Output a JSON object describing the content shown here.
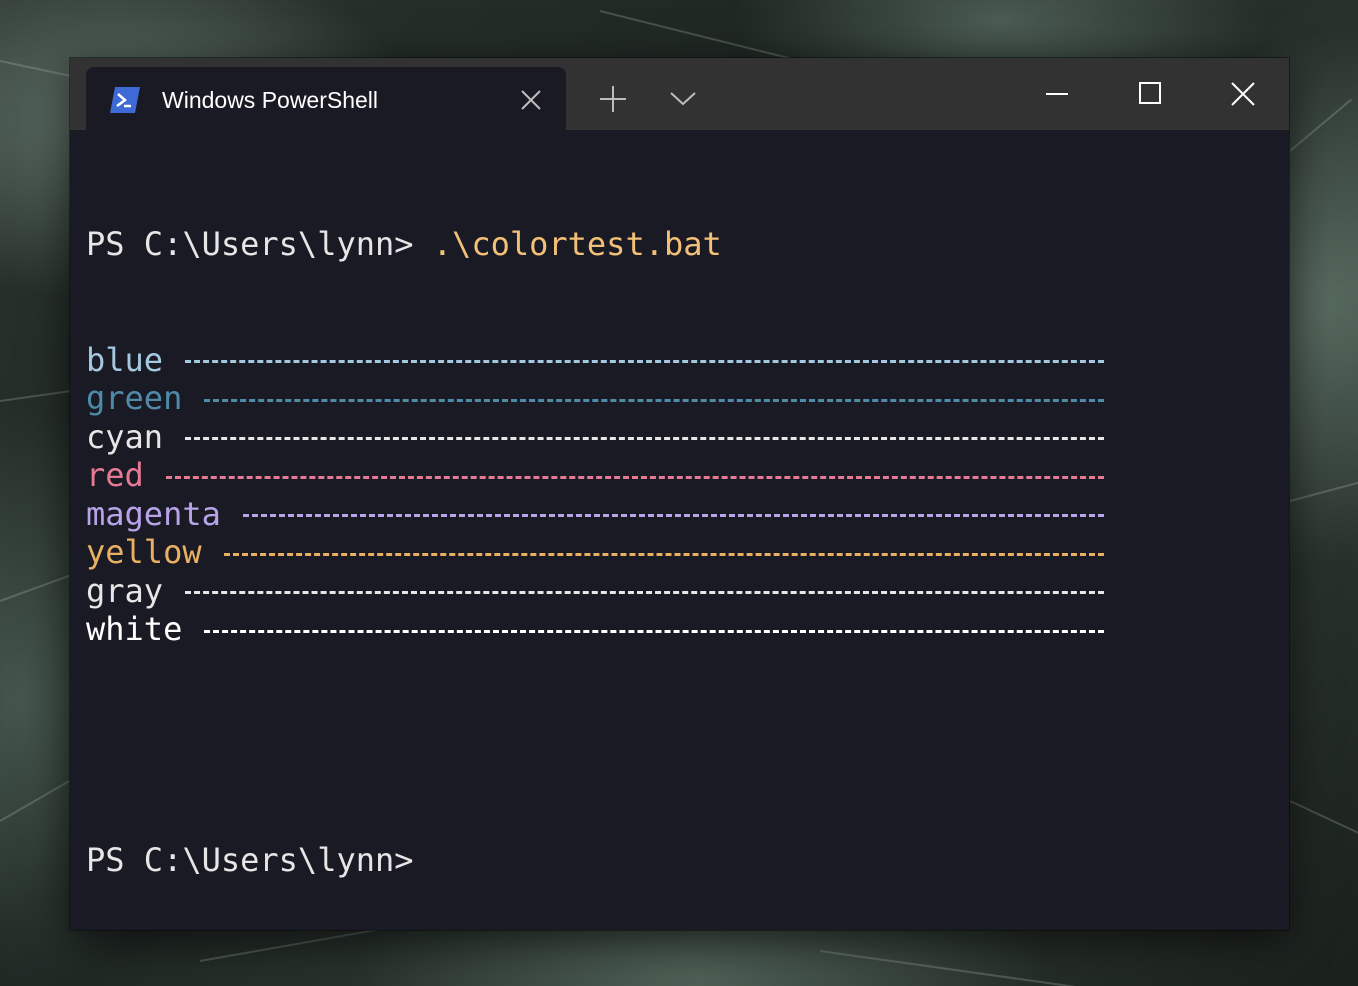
{
  "window": {
    "tab_title": "Windows PowerShell"
  },
  "icons": {
    "tab_icon": "powershell-icon",
    "tab_close": "close-icon",
    "new_tab": "plus-icon",
    "dropdown": "chevron-down-icon",
    "minimize": "minimize-icon",
    "maximize": "maximize-icon",
    "close": "close-icon"
  },
  "terminal": {
    "prompt1": "PS C:\\Users\\lynn>",
    "command1": " .\\colortest.bat",
    "lines": [
      {
        "label": "blue",
        "color": "#a3c8e0"
      },
      {
        "label": "green",
        "color": "#4f8ba8"
      },
      {
        "label": "cyan",
        "color": "#e6e6e6"
      },
      {
        "label": "red",
        "color": "#e57a95"
      },
      {
        "label": "magenta",
        "color": "#b8a3e8"
      },
      {
        "label": "yellow",
        "color": "#e8b063"
      },
      {
        "label": "gray",
        "color": "#e6e6e6"
      },
      {
        "label": "white",
        "color": "#ffffff"
      }
    ],
    "prompt2": "PS C:\\Users\\lynn>"
  },
  "colors": {
    "terminal_bg": "#1a1a24",
    "titlebar_bg": "#323232",
    "command": "#f2c078",
    "prompt": "#e6e6e6"
  }
}
